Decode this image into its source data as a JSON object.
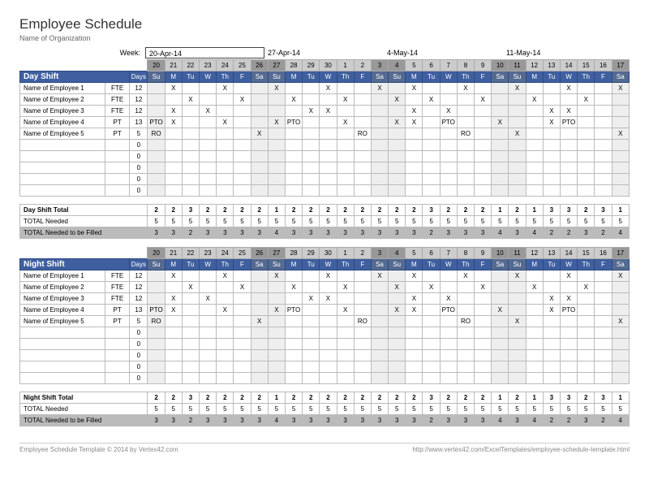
{
  "title": "Employee Schedule",
  "subtitle": "Name of Organization",
  "weekLabel": "Week:",
  "weekDates": [
    "20-Apr-14",
    "27-Apr-14",
    "4-May-14",
    "11-May-14"
  ],
  "dayNums": [
    "20",
    "21",
    "22",
    "23",
    "24",
    "25",
    "26",
    "27",
    "28",
    "29",
    "30",
    "1",
    "2",
    "3",
    "4",
    "5",
    "6",
    "7",
    "8",
    "9",
    "10",
    "11",
    "12",
    "13",
    "14",
    "15",
    "16",
    "17"
  ],
  "dows": [
    "Su",
    "M",
    "Tu",
    "W",
    "Th",
    "F",
    "Sa",
    "Su",
    "M",
    "Tu",
    "W",
    "Th",
    "F",
    "Sa",
    "Su",
    "M",
    "Tu",
    "W",
    "Th",
    "F",
    "Sa",
    "Su",
    "M",
    "Tu",
    "W",
    "Th",
    "F",
    "Sa"
  ],
  "wkndIdx": [
    0,
    6,
    7,
    13,
    14,
    20,
    21,
    27
  ],
  "daysLabel": "Days",
  "blankRows": 5,
  "shifts": [
    {
      "name": "Day Shift",
      "totalLabel": "Day Shift Total",
      "employees": [
        {
          "name": "Name of Employee 1",
          "type": "FTE",
          "days": "12",
          "cells": [
            "",
            "X",
            "",
            "",
            "X",
            "",
            "",
            "X",
            "",
            "",
            "X",
            "",
            "",
            "X",
            "",
            "X",
            "",
            "",
            "X",
            "",
            "",
            "X",
            "",
            "",
            "X",
            "",
            "",
            "X"
          ]
        },
        {
          "name": "Name of Employee 2",
          "type": "FTE",
          "days": "12",
          "cells": [
            "",
            "",
            "X",
            "",
            "",
            "X",
            "",
            "",
            "X",
            "",
            "",
            "X",
            "",
            "",
            "X",
            "",
            "X",
            "",
            "",
            "X",
            "",
            "",
            "X",
            "",
            "",
            "X",
            "",
            ""
          ]
        },
        {
          "name": "Name of Employee 3",
          "type": "FTE",
          "days": "12",
          "cells": [
            "",
            "X",
            "",
            "X",
            "",
            "",
            "",
            "",
            "",
            "X",
            "X",
            "",
            "",
            "",
            "",
            "X",
            "",
            "X",
            "",
            "",
            "",
            "",
            "",
            "X",
            "X",
            "",
            "",
            ""
          ]
        },
        {
          "name": "Name of Employee 4",
          "type": "PT",
          "days": "13",
          "cells": [
            "PTO",
            "X",
            "",
            "",
            "X",
            "",
            "",
            "X",
            "PTO",
            "",
            "",
            "X",
            "",
            "",
            "X",
            "X",
            "",
            "PTO",
            "",
            "",
            "X",
            "",
            "",
            "X",
            "PTO",
            "",
            "",
            ""
          ]
        },
        {
          "name": "Name of Employee 5",
          "type": "PT",
          "days": "5",
          "cells": [
            "RO",
            "",
            "",
            "",
            "",
            "",
            "X",
            "",
            "",
            "",
            "",
            "",
            "RO",
            "",
            "",
            "",
            "",
            "",
            "RO",
            "",
            "",
            "X",
            "",
            "",
            "",
            "",
            "",
            "X"
          ]
        }
      ]
    },
    {
      "name": "Night Shift",
      "totalLabel": "Night Shift Total",
      "employees": [
        {
          "name": "Name of Employee 1",
          "type": "FTE",
          "days": "12",
          "cells": [
            "",
            "X",
            "",
            "",
            "X",
            "",
            "",
            "X",
            "",
            "",
            "X",
            "",
            "",
            "X",
            "",
            "X",
            "",
            "",
            "X",
            "",
            "",
            "X",
            "",
            "",
            "X",
            "",
            "",
            "X"
          ]
        },
        {
          "name": "Name of Employee 2",
          "type": "FTE",
          "days": "12",
          "cells": [
            "",
            "",
            "X",
            "",
            "",
            "X",
            "",
            "",
            "X",
            "",
            "",
            "X",
            "",
            "",
            "X",
            "",
            "X",
            "",
            "",
            "X",
            "",
            "",
            "X",
            "",
            "",
            "X",
            "",
            ""
          ]
        },
        {
          "name": "Name of Employee 3",
          "type": "FTE",
          "days": "12",
          "cells": [
            "",
            "X",
            "",
            "X",
            "",
            "",
            "",
            "",
            "",
            "X",
            "X",
            "",
            "",
            "",
            "",
            "X",
            "",
            "X",
            "",
            "",
            "",
            "",
            "",
            "X",
            "X",
            "",
            "",
            ""
          ]
        },
        {
          "name": "Name of Employee 4",
          "type": "PT",
          "days": "13",
          "cells": [
            "PTO",
            "X",
            "",
            "",
            "X",
            "",
            "",
            "X",
            "PTO",
            "",
            "",
            "X",
            "",
            "",
            "X",
            "X",
            "",
            "PTO",
            "",
            "",
            "X",
            "",
            "",
            "X",
            "PTO",
            "",
            "",
            ""
          ]
        },
        {
          "name": "Name of Employee 5",
          "type": "PT",
          "days": "5",
          "cells": [
            "RO",
            "",
            "",
            "",
            "",
            "",
            "X",
            "",
            "",
            "",
            "",
            "",
            "RO",
            "",
            "",
            "",
            "",
            "",
            "RO",
            "",
            "",
            "X",
            "",
            "",
            "",
            "",
            "",
            "X"
          ]
        }
      ]
    }
  ],
  "totals": {
    "shiftTotal": [
      "2",
      "2",
      "3",
      "2",
      "2",
      "2",
      "2",
      "1",
      "2",
      "2",
      "2",
      "2",
      "2",
      "2",
      "2",
      "2",
      "3",
      "2",
      "2",
      "2",
      "1",
      "2",
      "1",
      "3",
      "3",
      "2",
      "3",
      "1"
    ],
    "neededLabel": "TOTAL Needed",
    "needed": [
      "5",
      "5",
      "5",
      "5",
      "5",
      "5",
      "5",
      "5",
      "5",
      "5",
      "5",
      "5",
      "5",
      "5",
      "5",
      "5",
      "5",
      "5",
      "5",
      "5",
      "5",
      "5",
      "5",
      "5",
      "5",
      "5",
      "5",
      "5"
    ],
    "fillLabel": "TOTAL Needed to be Filled",
    "fill": [
      "3",
      "3",
      "2",
      "3",
      "3",
      "3",
      "3",
      "4",
      "3",
      "3",
      "3",
      "3",
      "3",
      "3",
      "3",
      "3",
      "2",
      "3",
      "3",
      "3",
      "4",
      "3",
      "4",
      "2",
      "2",
      "3",
      "2",
      "4"
    ]
  },
  "footer": {
    "left": "Employee Schedule Template © 2014 by Vertex42.com",
    "right": "http://www.vertex42.com/ExcelTemplates/employee-schedule-template.html"
  }
}
